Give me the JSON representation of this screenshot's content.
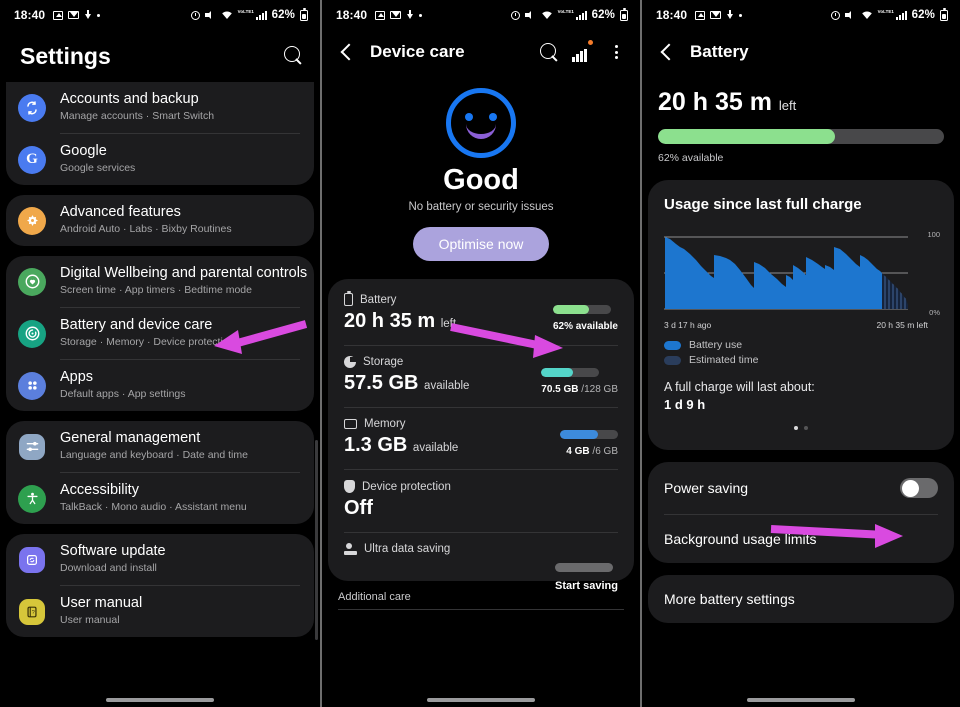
{
  "status_bar": {
    "time": "18:40",
    "battery_percent": "62%",
    "left_icons": [
      "photo-icon",
      "gmail-icon",
      "download-icon",
      "dot-icon"
    ],
    "right_icons": [
      "alarm-icon",
      "mute-icon",
      "wifi-icon",
      "volte-icon",
      "signal-icon",
      "battery-icon"
    ],
    "volte_label": "VoLTE1"
  },
  "settings_panel": {
    "title": "Settings",
    "search_icon": "search-icon",
    "groups": [
      {
        "items": [
          {
            "label": "Accounts and backup",
            "sublabel": "Manage accounts  ·  Smart Switch",
            "icon": "sync-icon",
            "color": "#4a7bf0"
          },
          {
            "label": "Google",
            "sublabel": "Google services",
            "icon": "google-icon",
            "color": "#4a7bf0"
          }
        ]
      },
      {
        "items": [
          {
            "label": "Advanced features",
            "sublabel": "Android Auto  ·  Labs  ·  Bixby Routines",
            "icon": "gear-star-icon",
            "color": "#f0a84a"
          }
        ]
      },
      {
        "items": [
          {
            "label": "Digital Wellbeing and parental controls",
            "sublabel": "Screen time  ·  App timers  ·  Bedtime mode",
            "icon": "heart-circle-icon",
            "color": "#4aa85e"
          },
          {
            "label": "Battery and device care",
            "sublabel": "Storage  ·  Memory  ·  Device protection",
            "icon": "device-care-icon",
            "color": "#17a383"
          },
          {
            "label": "Apps",
            "sublabel": "Default apps  ·  App settings",
            "icon": "apps-grid-icon",
            "color": "#5b7fdd"
          }
        ]
      },
      {
        "items": [
          {
            "label": "General management",
            "sublabel": "Language and keyboard  ·  Date and time",
            "icon": "sliders-icon",
            "color": "#8fa7c4"
          },
          {
            "label": "Accessibility",
            "sublabel": "TalkBack  ·  Mono audio  ·  Assistant menu",
            "icon": "accessibility-icon",
            "color": "#2ea04f"
          }
        ]
      },
      {
        "items": [
          {
            "label": "Software update",
            "sublabel": "Download and install",
            "icon": "update-icon",
            "color": "#7a73ee"
          },
          {
            "label": "User manual",
            "sublabel": "User manual",
            "icon": "manual-icon",
            "color": "#d6c63a"
          }
        ]
      }
    ]
  },
  "device_care_panel": {
    "nav_title": "Device care",
    "nav_actions": [
      "search-icon",
      "chart-icon",
      "more-options-icon"
    ],
    "status_face": "smiley-icon",
    "status_title": "Good",
    "status_sub": "No battery or security issues",
    "optimise_label": "Optimise now",
    "items": [
      {
        "label": "Battery",
        "icon": "battery-icon",
        "value": "20 h 35 m",
        "value_suffix": "left",
        "bar_percent": 62,
        "bar_color": "#8ce08e",
        "right_text": "62% available"
      },
      {
        "label": "Storage",
        "icon": "storage-pie-icon",
        "value": "57.5 GB",
        "value_suffix": "available",
        "bar_percent": 55,
        "bar_color": "#54d5c9",
        "right_text": "70.5 GB",
        "right_text2": "/128 GB"
      },
      {
        "label": "Memory",
        "icon": "memory-icon",
        "value": "1.3 GB",
        "value_suffix": "available",
        "bar_percent": 66,
        "bar_color": "#3d8bdc",
        "right_text": "4 GB",
        "right_text2": "/6 GB"
      },
      {
        "label": "Device protection",
        "icon": "shield-icon",
        "value": "Off",
        "value_suffix": "",
        "bar_percent": 0,
        "bar_color": "#48484a",
        "right_text": ""
      },
      {
        "label": "Ultra data saving",
        "icon": "ultra-data-icon",
        "value": "",
        "value_suffix": "",
        "bar_percent": 0,
        "bar_color": "#6a6a6c",
        "right_text": "Start saving"
      }
    ],
    "additional_care": "Additional care"
  },
  "battery_panel": {
    "nav_title": "Battery",
    "time_left": "20 h 35 m",
    "time_left_suffix": "left",
    "bar_percent": 62,
    "bar_color": "#8ce08e",
    "available_text": "62% available",
    "usage_title": "Usage since last full charge",
    "legend": [
      {
        "label": "Battery use",
        "color": "#1d76cf"
      },
      {
        "label": "Estimated time",
        "color": "#2a3d5c"
      }
    ],
    "full_charge_label": "A full charge will last about:",
    "full_charge_value": "1 d 9 h",
    "page_dots": 2,
    "active_dot": 0,
    "rows": [
      {
        "label": "Power saving",
        "control": "toggle",
        "toggle_on": false
      },
      {
        "label": "Background usage limits",
        "control": "none"
      }
    ],
    "more_settings": "More battery settings",
    "chart_data": {
      "type": "area",
      "title": "Usage since last full charge",
      "xlabel": "",
      "ylabel": "",
      "ylim": [
        0,
        100
      ],
      "ytick_labels": [
        "100",
        "0%"
      ],
      "xtick_labels": [
        "3 d 17 h ago",
        "20 h 35 m left"
      ],
      "grid": true,
      "legend_position": "below",
      "series": [
        {
          "name": "Battery use",
          "color": "#1d76cf",
          "x": [
            0,
            2,
            5,
            8,
            10,
            13,
            16,
            18,
            20,
            22,
            24,
            26,
            28,
            30,
            32,
            34,
            36,
            38,
            40,
            42,
            44,
            46,
            48,
            50,
            52,
            54,
            56,
            58,
            60,
            62,
            64,
            66,
            68,
            70,
            72,
            74,
            76
          ],
          "values": [
            100,
            97,
            92,
            88,
            86,
            80,
            72,
            63,
            57,
            52,
            50,
            68,
            66,
            64,
            60,
            52,
            44,
            38,
            33,
            30,
            72,
            66,
            58,
            50,
            46,
            40,
            42,
            58,
            50,
            48,
            74,
            68,
            62,
            88,
            84,
            78,
            70
          ]
        },
        {
          "name": "Estimated time",
          "color": "#2a3d5c",
          "x": [
            76,
            80,
            85,
            90,
            95,
            100
          ],
          "values": [
            62,
            50,
            38,
            25,
            12,
            0
          ]
        }
      ]
    }
  },
  "annotations": {
    "arrow_color": "#d94ae0",
    "arrows": [
      {
        "target": "battery-and-device-care-row"
      },
      {
        "target": "battery-usage-bar"
      },
      {
        "target": "power-saving-toggle"
      }
    ]
  },
  "home_indicator": "home-indicator"
}
